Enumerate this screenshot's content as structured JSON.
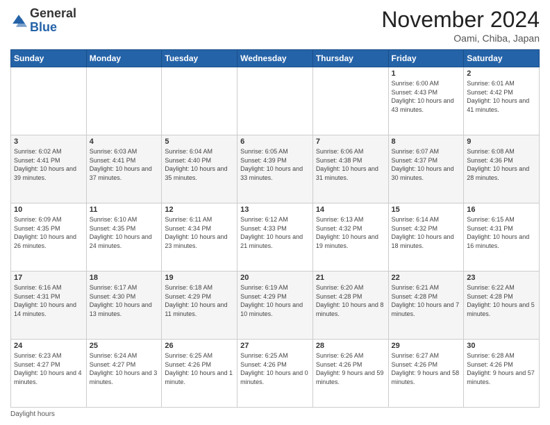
{
  "header": {
    "logo_general": "General",
    "logo_blue": "Blue",
    "month_title": "November 2024",
    "location": "Oami, Chiba, Japan"
  },
  "days_of_week": [
    "Sunday",
    "Monday",
    "Tuesday",
    "Wednesday",
    "Thursday",
    "Friday",
    "Saturday"
  ],
  "weeks": [
    [
      {
        "day": "",
        "info": ""
      },
      {
        "day": "",
        "info": ""
      },
      {
        "day": "",
        "info": ""
      },
      {
        "day": "",
        "info": ""
      },
      {
        "day": "",
        "info": ""
      },
      {
        "day": "1",
        "info": "Sunrise: 6:00 AM\nSunset: 4:43 PM\nDaylight: 10 hours and 43 minutes."
      },
      {
        "day": "2",
        "info": "Sunrise: 6:01 AM\nSunset: 4:42 PM\nDaylight: 10 hours and 41 minutes."
      }
    ],
    [
      {
        "day": "3",
        "info": "Sunrise: 6:02 AM\nSunset: 4:41 PM\nDaylight: 10 hours and 39 minutes."
      },
      {
        "day": "4",
        "info": "Sunrise: 6:03 AM\nSunset: 4:41 PM\nDaylight: 10 hours and 37 minutes."
      },
      {
        "day": "5",
        "info": "Sunrise: 6:04 AM\nSunset: 4:40 PM\nDaylight: 10 hours and 35 minutes."
      },
      {
        "day": "6",
        "info": "Sunrise: 6:05 AM\nSunset: 4:39 PM\nDaylight: 10 hours and 33 minutes."
      },
      {
        "day": "7",
        "info": "Sunrise: 6:06 AM\nSunset: 4:38 PM\nDaylight: 10 hours and 31 minutes."
      },
      {
        "day": "8",
        "info": "Sunrise: 6:07 AM\nSunset: 4:37 PM\nDaylight: 10 hours and 30 minutes."
      },
      {
        "day": "9",
        "info": "Sunrise: 6:08 AM\nSunset: 4:36 PM\nDaylight: 10 hours and 28 minutes."
      }
    ],
    [
      {
        "day": "10",
        "info": "Sunrise: 6:09 AM\nSunset: 4:35 PM\nDaylight: 10 hours and 26 minutes."
      },
      {
        "day": "11",
        "info": "Sunrise: 6:10 AM\nSunset: 4:35 PM\nDaylight: 10 hours and 24 minutes."
      },
      {
        "day": "12",
        "info": "Sunrise: 6:11 AM\nSunset: 4:34 PM\nDaylight: 10 hours and 23 minutes."
      },
      {
        "day": "13",
        "info": "Sunrise: 6:12 AM\nSunset: 4:33 PM\nDaylight: 10 hours and 21 minutes."
      },
      {
        "day": "14",
        "info": "Sunrise: 6:13 AM\nSunset: 4:32 PM\nDaylight: 10 hours and 19 minutes."
      },
      {
        "day": "15",
        "info": "Sunrise: 6:14 AM\nSunset: 4:32 PM\nDaylight: 10 hours and 18 minutes."
      },
      {
        "day": "16",
        "info": "Sunrise: 6:15 AM\nSunset: 4:31 PM\nDaylight: 10 hours and 16 minutes."
      }
    ],
    [
      {
        "day": "17",
        "info": "Sunrise: 6:16 AM\nSunset: 4:31 PM\nDaylight: 10 hours and 14 minutes."
      },
      {
        "day": "18",
        "info": "Sunrise: 6:17 AM\nSunset: 4:30 PM\nDaylight: 10 hours and 13 minutes."
      },
      {
        "day": "19",
        "info": "Sunrise: 6:18 AM\nSunset: 4:29 PM\nDaylight: 10 hours and 11 minutes."
      },
      {
        "day": "20",
        "info": "Sunrise: 6:19 AM\nSunset: 4:29 PM\nDaylight: 10 hours and 10 minutes."
      },
      {
        "day": "21",
        "info": "Sunrise: 6:20 AM\nSunset: 4:28 PM\nDaylight: 10 hours and 8 minutes."
      },
      {
        "day": "22",
        "info": "Sunrise: 6:21 AM\nSunset: 4:28 PM\nDaylight: 10 hours and 7 minutes."
      },
      {
        "day": "23",
        "info": "Sunrise: 6:22 AM\nSunset: 4:28 PM\nDaylight: 10 hours and 5 minutes."
      }
    ],
    [
      {
        "day": "24",
        "info": "Sunrise: 6:23 AM\nSunset: 4:27 PM\nDaylight: 10 hours and 4 minutes."
      },
      {
        "day": "25",
        "info": "Sunrise: 6:24 AM\nSunset: 4:27 PM\nDaylight: 10 hours and 3 minutes."
      },
      {
        "day": "26",
        "info": "Sunrise: 6:25 AM\nSunset: 4:26 PM\nDaylight: 10 hours and 1 minute."
      },
      {
        "day": "27",
        "info": "Sunrise: 6:25 AM\nSunset: 4:26 PM\nDaylight: 10 hours and 0 minutes."
      },
      {
        "day": "28",
        "info": "Sunrise: 6:26 AM\nSunset: 4:26 PM\nDaylight: 9 hours and 59 minutes."
      },
      {
        "day": "29",
        "info": "Sunrise: 6:27 AM\nSunset: 4:26 PM\nDaylight: 9 hours and 58 minutes."
      },
      {
        "day": "30",
        "info": "Sunrise: 6:28 AM\nSunset: 4:26 PM\nDaylight: 9 hours and 57 minutes."
      }
    ]
  ],
  "footnote": "Daylight hours"
}
